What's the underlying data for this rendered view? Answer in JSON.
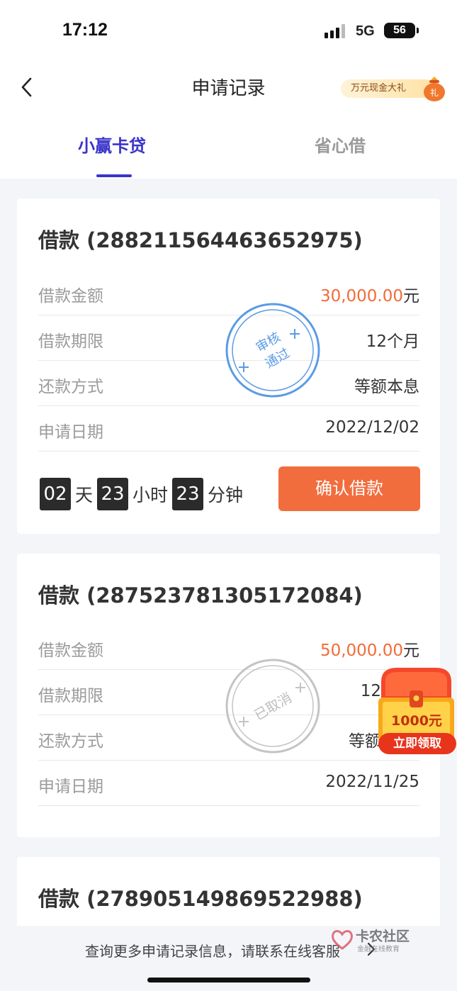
{
  "status_bar": {
    "time": "17:12",
    "network": "5G",
    "battery": "56"
  },
  "header": {
    "title": "申请记录",
    "promo_label": "万元现金大礼",
    "promo_bag_char": "礼"
  },
  "tabs": [
    {
      "label": "小赢卡贷",
      "active": true
    },
    {
      "label": "省心借",
      "active": false
    }
  ],
  "loans": [
    {
      "title": "借款 (2882115644636529​75)",
      "rows": [
        {
          "label": "借款金额",
          "value": "30,000.00",
          "unit": "元"
        },
        {
          "label": "借款期限",
          "value": "12个月"
        },
        {
          "label": "还款方式",
          "value": "等额本息"
        },
        {
          "label": "申请日期",
          "value": "2022/12/02"
        }
      ],
      "stamp": {
        "line1": "审核",
        "line2": "通过",
        "color": "#4a90e2"
      },
      "countdown": {
        "days": "02",
        "days_unit": "天",
        "hours": "23",
        "hours_unit": "小时",
        "minutes": "23",
        "minutes_unit": "分钟"
      },
      "action_label": "确认借款"
    },
    {
      "title": "借款 (287523781305172084)",
      "rows": [
        {
          "label": "借款金额",
          "value": "50,000.00",
          "unit": "元"
        },
        {
          "label": "借款期限",
          "value": "12"
        },
        {
          "label": "还款方式",
          "value": "等额"
        },
        {
          "label": "申请日期",
          "value": "2022/11/25"
        }
      ],
      "stamp": {
        "line1": "已取消",
        "color": "#bdbdbd"
      }
    },
    {
      "title": "借款 (278905149869522988)"
    }
  ],
  "gift": {
    "amount": "1000元",
    "cta": "立即领取"
  },
  "footer": {
    "text": "查询更多申请记录信息，请联系在线客服",
    "watermark_title": "卡农社区",
    "watermark_sub": "金融在线教育"
  },
  "colors": {
    "accent": "#3b35c9",
    "amount": "#f26b38",
    "button": "#f26d3d"
  }
}
